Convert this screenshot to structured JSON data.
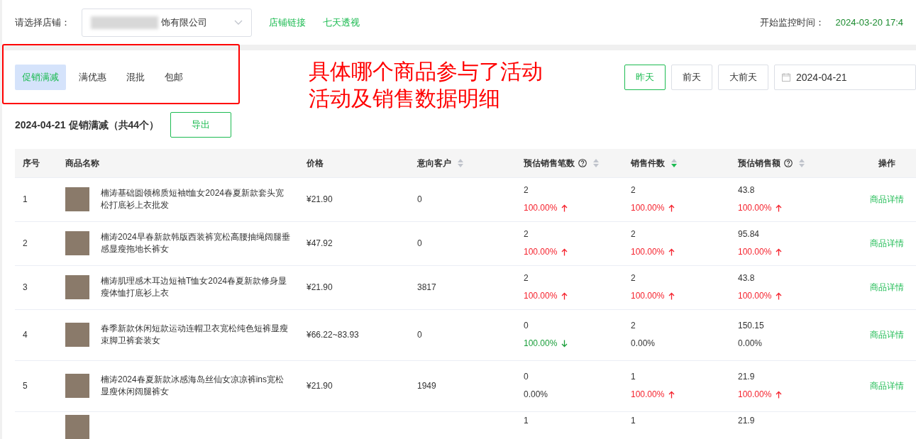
{
  "store_bar": {
    "label": "请选择店铺：",
    "store_name": "饰有限公司",
    "links": [
      "店铺链接",
      "七天透视"
    ],
    "monitor_label": "开始监控时间：",
    "monitor_time": "2024-03-20 17:4"
  },
  "activity_tabs": [
    {
      "label": "促销满减",
      "selected": true
    },
    {
      "label": "满优惠",
      "selected": false
    },
    {
      "label": "混批",
      "selected": false
    },
    {
      "label": "包邮",
      "selected": false
    }
  ],
  "annotation": {
    "lines": [
      "具体哪个商品参与了活动",
      "活动及销售数据明细"
    ]
  },
  "date_buttons": [
    {
      "label": "昨天",
      "selected": true
    },
    {
      "label": "前天",
      "selected": false
    },
    {
      "label": "大前天",
      "selected": false
    }
  ],
  "date_field": {
    "value": "2024-04-21"
  },
  "summary": {
    "title": "2024-04-21 促销满减（共44个）",
    "export_label": "导出"
  },
  "table": {
    "columns": [
      {
        "label": "序号",
        "help": false,
        "sortable": false
      },
      {
        "label": "商品名称",
        "help": false,
        "sortable": false
      },
      {
        "label": "价格",
        "help": false,
        "sortable": false
      },
      {
        "label": "意向客户",
        "help": false,
        "sortable": true,
        "sorted": false
      },
      {
        "label": "预估销售笔数",
        "help": true,
        "sortable": true,
        "sorted": false
      },
      {
        "label": "销售件数",
        "help": false,
        "sortable": true,
        "sorted": true
      },
      {
        "label": "预估销售额",
        "help": true,
        "sortable": true,
        "sorted": false
      },
      {
        "label": "操作",
        "help": false,
        "sortable": false
      }
    ],
    "rows": [
      {
        "index": "1",
        "name": "楠涛基础圆领棉质短袖t恤女2024春夏新款套头宽松打底衫上衣批发",
        "price": "¥21.90",
        "prospects": "0",
        "orders": {
          "value": "2",
          "change": "100.00%",
          "rising": true,
          "falling": false
        },
        "units": {
          "value": "2",
          "change": "100.00%",
          "rising": true,
          "falling": false
        },
        "amount": {
          "value": "43.8",
          "change": "100.00%",
          "rising": true,
          "falling": false
        },
        "action": "商品详情"
      },
      {
        "index": "2",
        "name": "楠涛2024早春新款韩版西装裤宽松高腰抽绳阔腿垂感显瘦拖地长裤女",
        "price": "¥47.92",
        "prospects": "0",
        "orders": {
          "value": "2",
          "change": "100.00%",
          "rising": true,
          "falling": false
        },
        "units": {
          "value": "2",
          "change": "100.00%",
          "rising": true,
          "falling": false
        },
        "amount": {
          "value": "95.84",
          "change": "100.00%",
          "rising": true,
          "falling": false
        },
        "action": "商品详情"
      },
      {
        "index": "3",
        "name": "楠涛肌理感木耳边短袖T恤女2024春夏新款修身显瘦体恤打底衫上衣",
        "price": "¥21.90",
        "prospects": "3817",
        "orders": {
          "value": "2",
          "change": "100.00%",
          "rising": true,
          "falling": false
        },
        "units": {
          "value": "2",
          "change": "100.00%",
          "rising": true,
          "falling": false
        },
        "amount": {
          "value": "43.8",
          "change": "100.00%",
          "rising": true,
          "falling": false
        },
        "action": "商品详情"
      },
      {
        "index": "4",
        "name": "春季新款休闲短款运动连帽卫衣宽松纯色短裤显瘦束脚卫裤套装女",
        "price": "¥66.22~83.93",
        "prospects": "0",
        "orders": {
          "value": "0",
          "change": "100.00%",
          "rising": false,
          "falling": true
        },
        "units": {
          "value": "2",
          "change": "0.00%",
          "rising": false,
          "falling": false
        },
        "amount": {
          "value": "150.15",
          "change": "0.00%",
          "rising": false,
          "falling": false
        },
        "action": "商品详情"
      },
      {
        "index": "5",
        "name": "楠涛2024春夏新款冰感海岛丝仙女凉凉裤ins宽松显瘦休闲阔腿裤女",
        "price": "¥21.90",
        "prospects": "1949",
        "orders": {
          "value": "0",
          "change": "0.00%",
          "rising": false,
          "falling": false
        },
        "units": {
          "value": "1",
          "change": "100.00%",
          "rising": true,
          "falling": false
        },
        "amount": {
          "value": "21.9",
          "change": "100.00%",
          "rising": true,
          "falling": false
        },
        "action": "商品详情"
      },
      {
        "orders": {
          "value": "1"
        },
        "units": {
          "value": "1"
        },
        "amount": {
          "value": "21.9"
        }
      }
    ]
  }
}
